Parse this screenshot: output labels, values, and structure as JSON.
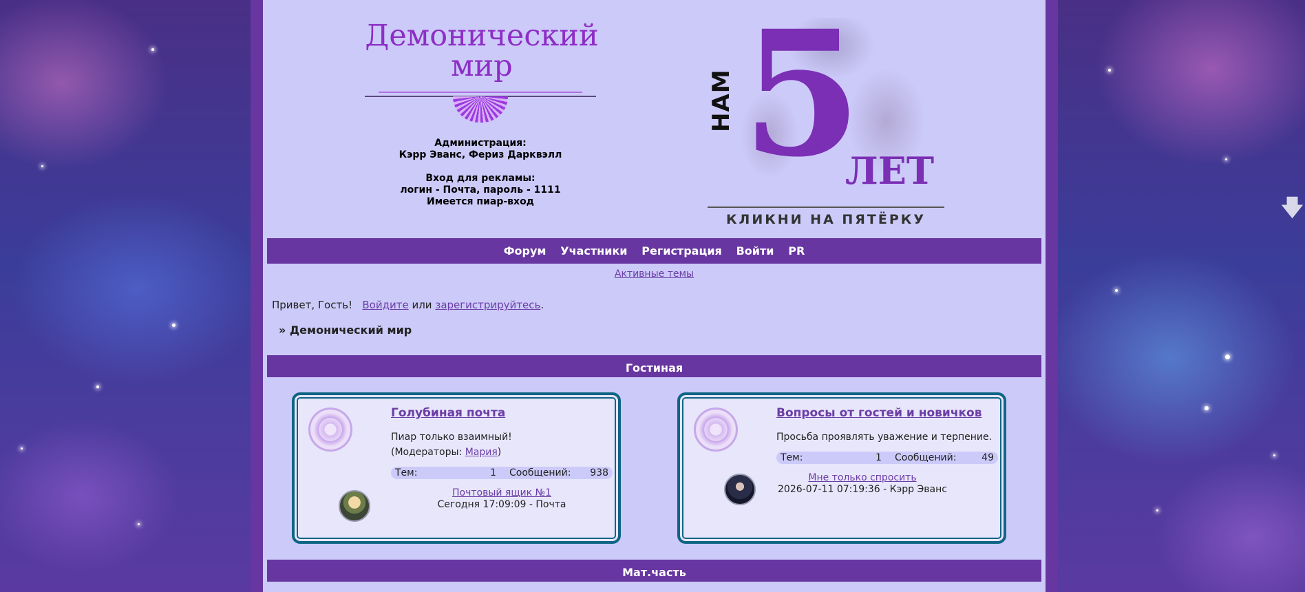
{
  "header": {
    "logo_line1": "Демонический",
    "logo_line2": "мир",
    "admin": [
      "Администрация:",
      "Кэрр Эванс, Фериз Дарквэлл",
      "",
      "Вход для рекламы:",
      "логин - Почта, пароль - 1111",
      "Имеется пиар-вход"
    ],
    "banner": {
      "nam": "НАМ",
      "number": "5",
      "let": "ЛЕТ",
      "subtitle": "КЛИКНИ НА ПЯТЁРКУ"
    }
  },
  "nav": {
    "items": [
      "Форум",
      "Участники",
      "Регистрация",
      "Войти",
      "PR"
    ]
  },
  "active_topics": "Активные темы",
  "greeting": {
    "prefix": "Привет, Гость!",
    "login_link": "Войдите",
    "or": "или",
    "register_link": "зарегистрируйтесь",
    "suffix": "."
  },
  "breadcrumb": "» Демонический мир",
  "sections": [
    {
      "title": "Гостиная",
      "forums": [
        {
          "title": "Голубиная почта",
          "description": "Пиар только взаимный!",
          "moderators_prefix": "(Модераторы: ",
          "moderator": "Мария",
          "moderators_suffix": ")",
          "topics_label": "Тем:",
          "topics": "1",
          "posts_label": "Сообщений:",
          "posts": "938",
          "last_topic": "Почтовый ящик №1",
          "last_info": "Сегодня 17:09:09 - Почта"
        },
        {
          "title": "Вопросы от гостей и новичков",
          "description": "Просьба проявлять уважение и терпение.",
          "topics_label": "Тем:",
          "topics": "1",
          "posts_label": "Сообщений:",
          "posts": "49",
          "last_topic": "Мне только спросить",
          "last_info": "2026-07-11 07:19:36 - Кэрр Эванс"
        }
      ]
    },
    {
      "title": "Мат.часть"
    }
  ],
  "colors": {
    "frame": "#6736a0",
    "content_bg": "#cccaf9",
    "card_border": "#0f6585",
    "link": "#6b3ea6",
    "logo": "#8d2ec6"
  },
  "icons": {
    "scroll": "arrow-down-icon"
  }
}
